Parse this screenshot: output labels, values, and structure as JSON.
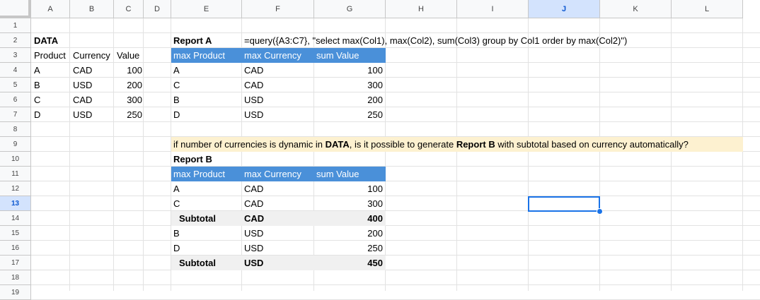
{
  "columns": [
    "A",
    "B",
    "C",
    "D",
    "E",
    "F",
    "G",
    "H",
    "I",
    "J",
    "K",
    "L"
  ],
  "rows": [
    "1",
    "2",
    "3",
    "4",
    "5",
    "6",
    "7",
    "8",
    "9",
    "10",
    "11",
    "12",
    "13",
    "14",
    "15",
    "16",
    "17",
    "18",
    "19"
  ],
  "active": {
    "column": "J",
    "row": "13"
  },
  "data_table": {
    "title": "DATA",
    "headers": [
      "Product",
      "Currency",
      "Value"
    ],
    "rows": [
      [
        "A",
        "CAD",
        "100"
      ],
      [
        "B",
        "USD",
        "200"
      ],
      [
        "C",
        "CAD",
        "300"
      ],
      [
        "D",
        "USD",
        "250"
      ]
    ]
  },
  "report_a": {
    "title": "Report A",
    "formula": "=query({A3:C7}, \"select max(Col1), max(Col2), sum(Col3) group by Col1 order by max(Col2)\")",
    "headers": [
      "max Product",
      "max Currency",
      "sum Value"
    ],
    "rows": [
      [
        "A",
        "CAD",
        "100"
      ],
      [
        "C",
        "CAD",
        "300"
      ],
      [
        "B",
        "USD",
        "200"
      ],
      [
        "D",
        "USD",
        "250"
      ]
    ]
  },
  "question": {
    "part1": "if number of currencies is dynamic in ",
    "bold1": "DATA",
    "part2": ", is it possible to generate ",
    "bold2": "Report B",
    "part3": " with subtotal based on currency automatically?"
  },
  "report_b": {
    "title": "Report B",
    "headers": [
      "max Product",
      "max Currency",
      "sum Value"
    ],
    "rows": [
      [
        "A",
        "CAD",
        "100"
      ],
      [
        "C",
        "CAD",
        "300"
      ],
      [
        "Subtotal",
        "CAD",
        "400"
      ],
      [
        "B",
        "USD",
        "200"
      ],
      [
        "D",
        "USD",
        "250"
      ],
      [
        "Subtotal",
        "USD",
        "450"
      ]
    ]
  },
  "colors": {
    "header_blue": "#4a90d9",
    "subtotal_grey": "#f0f0f0",
    "note_yellow": "#fdf1d0",
    "selection": "#1a73e8"
  }
}
